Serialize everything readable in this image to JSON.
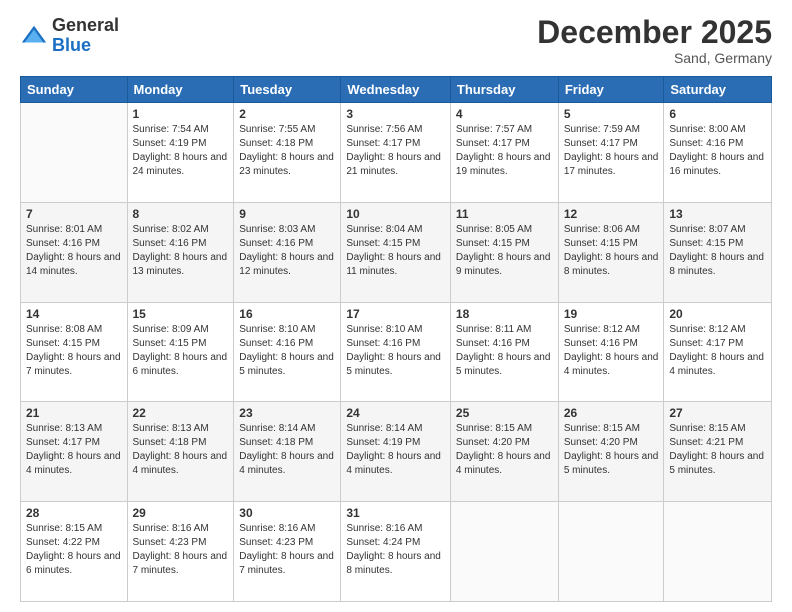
{
  "header": {
    "logo_general": "General",
    "logo_blue": "Blue",
    "month_title": "December 2025",
    "location": "Sand, Germany"
  },
  "days_of_week": [
    "Sunday",
    "Monday",
    "Tuesday",
    "Wednesday",
    "Thursday",
    "Friday",
    "Saturday"
  ],
  "weeks": [
    [
      {
        "day": "",
        "sunrise": "",
        "sunset": "",
        "daylight": ""
      },
      {
        "day": "1",
        "sunrise": "Sunrise: 7:54 AM",
        "sunset": "Sunset: 4:19 PM",
        "daylight": "Daylight: 8 hours and 24 minutes."
      },
      {
        "day": "2",
        "sunrise": "Sunrise: 7:55 AM",
        "sunset": "Sunset: 4:18 PM",
        "daylight": "Daylight: 8 hours and 23 minutes."
      },
      {
        "day": "3",
        "sunrise": "Sunrise: 7:56 AM",
        "sunset": "Sunset: 4:17 PM",
        "daylight": "Daylight: 8 hours and 21 minutes."
      },
      {
        "day": "4",
        "sunrise": "Sunrise: 7:57 AM",
        "sunset": "Sunset: 4:17 PM",
        "daylight": "Daylight: 8 hours and 19 minutes."
      },
      {
        "day": "5",
        "sunrise": "Sunrise: 7:59 AM",
        "sunset": "Sunset: 4:17 PM",
        "daylight": "Daylight: 8 hours and 17 minutes."
      },
      {
        "day": "6",
        "sunrise": "Sunrise: 8:00 AM",
        "sunset": "Sunset: 4:16 PM",
        "daylight": "Daylight: 8 hours and 16 minutes."
      }
    ],
    [
      {
        "day": "7",
        "sunrise": "Sunrise: 8:01 AM",
        "sunset": "Sunset: 4:16 PM",
        "daylight": "Daylight: 8 hours and 14 minutes."
      },
      {
        "day": "8",
        "sunrise": "Sunrise: 8:02 AM",
        "sunset": "Sunset: 4:16 PM",
        "daylight": "Daylight: 8 hours and 13 minutes."
      },
      {
        "day": "9",
        "sunrise": "Sunrise: 8:03 AM",
        "sunset": "Sunset: 4:16 PM",
        "daylight": "Daylight: 8 hours and 12 minutes."
      },
      {
        "day": "10",
        "sunrise": "Sunrise: 8:04 AM",
        "sunset": "Sunset: 4:15 PM",
        "daylight": "Daylight: 8 hours and 11 minutes."
      },
      {
        "day": "11",
        "sunrise": "Sunrise: 8:05 AM",
        "sunset": "Sunset: 4:15 PM",
        "daylight": "Daylight: 8 hours and 9 minutes."
      },
      {
        "day": "12",
        "sunrise": "Sunrise: 8:06 AM",
        "sunset": "Sunset: 4:15 PM",
        "daylight": "Daylight: 8 hours and 8 minutes."
      },
      {
        "day": "13",
        "sunrise": "Sunrise: 8:07 AM",
        "sunset": "Sunset: 4:15 PM",
        "daylight": "Daylight: 8 hours and 8 minutes."
      }
    ],
    [
      {
        "day": "14",
        "sunrise": "Sunrise: 8:08 AM",
        "sunset": "Sunset: 4:15 PM",
        "daylight": "Daylight: 8 hours and 7 minutes."
      },
      {
        "day": "15",
        "sunrise": "Sunrise: 8:09 AM",
        "sunset": "Sunset: 4:15 PM",
        "daylight": "Daylight: 8 hours and 6 minutes."
      },
      {
        "day": "16",
        "sunrise": "Sunrise: 8:10 AM",
        "sunset": "Sunset: 4:16 PM",
        "daylight": "Daylight: 8 hours and 5 minutes."
      },
      {
        "day": "17",
        "sunrise": "Sunrise: 8:10 AM",
        "sunset": "Sunset: 4:16 PM",
        "daylight": "Daylight: 8 hours and 5 minutes."
      },
      {
        "day": "18",
        "sunrise": "Sunrise: 8:11 AM",
        "sunset": "Sunset: 4:16 PM",
        "daylight": "Daylight: 8 hours and 5 minutes."
      },
      {
        "day": "19",
        "sunrise": "Sunrise: 8:12 AM",
        "sunset": "Sunset: 4:16 PM",
        "daylight": "Daylight: 8 hours and 4 minutes."
      },
      {
        "day": "20",
        "sunrise": "Sunrise: 8:12 AM",
        "sunset": "Sunset: 4:17 PM",
        "daylight": "Daylight: 8 hours and 4 minutes."
      }
    ],
    [
      {
        "day": "21",
        "sunrise": "Sunrise: 8:13 AM",
        "sunset": "Sunset: 4:17 PM",
        "daylight": "Daylight: 8 hours and 4 minutes."
      },
      {
        "day": "22",
        "sunrise": "Sunrise: 8:13 AM",
        "sunset": "Sunset: 4:18 PM",
        "daylight": "Daylight: 8 hours and 4 minutes."
      },
      {
        "day": "23",
        "sunrise": "Sunrise: 8:14 AM",
        "sunset": "Sunset: 4:18 PM",
        "daylight": "Daylight: 8 hours and 4 minutes."
      },
      {
        "day": "24",
        "sunrise": "Sunrise: 8:14 AM",
        "sunset": "Sunset: 4:19 PM",
        "daylight": "Daylight: 8 hours and 4 minutes."
      },
      {
        "day": "25",
        "sunrise": "Sunrise: 8:15 AM",
        "sunset": "Sunset: 4:20 PM",
        "daylight": "Daylight: 8 hours and 4 minutes."
      },
      {
        "day": "26",
        "sunrise": "Sunrise: 8:15 AM",
        "sunset": "Sunset: 4:20 PM",
        "daylight": "Daylight: 8 hours and 5 minutes."
      },
      {
        "day": "27",
        "sunrise": "Sunrise: 8:15 AM",
        "sunset": "Sunset: 4:21 PM",
        "daylight": "Daylight: 8 hours and 5 minutes."
      }
    ],
    [
      {
        "day": "28",
        "sunrise": "Sunrise: 8:15 AM",
        "sunset": "Sunset: 4:22 PM",
        "daylight": "Daylight: 8 hours and 6 minutes."
      },
      {
        "day": "29",
        "sunrise": "Sunrise: 8:16 AM",
        "sunset": "Sunset: 4:23 PM",
        "daylight": "Daylight: 8 hours and 7 minutes."
      },
      {
        "day": "30",
        "sunrise": "Sunrise: 8:16 AM",
        "sunset": "Sunset: 4:23 PM",
        "daylight": "Daylight: 8 hours and 7 minutes."
      },
      {
        "day": "31",
        "sunrise": "Sunrise: 8:16 AM",
        "sunset": "Sunset: 4:24 PM",
        "daylight": "Daylight: 8 hours and 8 minutes."
      },
      {
        "day": "",
        "sunrise": "",
        "sunset": "",
        "daylight": ""
      },
      {
        "day": "",
        "sunrise": "",
        "sunset": "",
        "daylight": ""
      },
      {
        "day": "",
        "sunrise": "",
        "sunset": "",
        "daylight": ""
      }
    ]
  ]
}
